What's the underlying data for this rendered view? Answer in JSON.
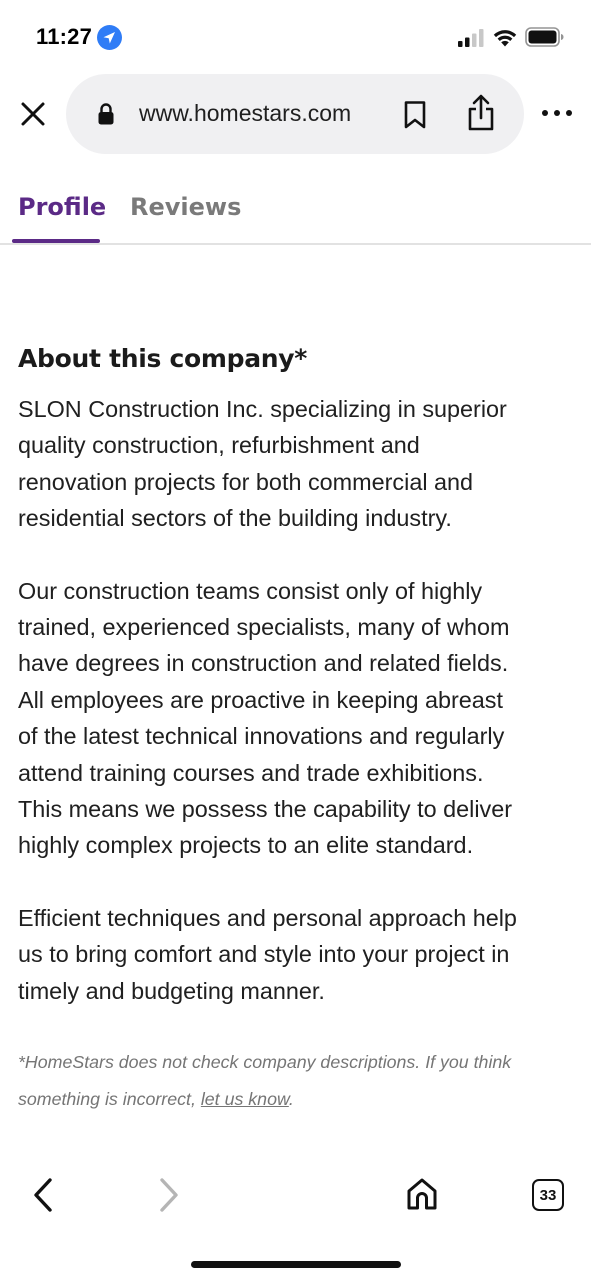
{
  "status_bar": {
    "time": "11:27",
    "icons": [
      "location-arrow-icon",
      "cellular-signal-icon",
      "wifi-icon",
      "battery-icon"
    ]
  },
  "browser": {
    "url": "www.homestars.com",
    "icons": [
      "close-icon",
      "lock-icon",
      "bookmark-icon",
      "share-icon",
      "more-icon"
    ]
  },
  "tabs": {
    "items": [
      {
        "label": "Profile",
        "active": true
      },
      {
        "label": "Reviews",
        "active": false
      }
    ],
    "active_color": "#5b2a86"
  },
  "about": {
    "heading": "About this company*",
    "paragraphs": [
      "SLON Construction Inc. specializing in superior\nquality construction, refurbishment and\nrenovation projects for both commercial and\nresidential sectors of the building industry.",
      "Our construction teams consist only of highly\ntrained, experienced specialists, many of whom\nhave degrees in construction and related fields.\nAll employees are proactive in keeping abreast\nof the latest technical innovations and regularly\nattend training courses and trade exhibitions.\nThis means we possess the capability to deliver\nhighly complex projects to an elite standard.",
      "Efficient techniques and personal approach help\nus to bring comfort and style into your project in\ntimely and budgeting manner."
    ],
    "disclaimer_text": "*HomeStars does not check company descriptions. If you think something is incorrect,",
    "disclaimer_link": "let us know",
    "disclaimer_end": "."
  },
  "toolbar": {
    "tab_count": "33",
    "icons": [
      "chevron-left-icon",
      "chevron-right-icon",
      "home-icon",
      "tabs-icon"
    ]
  }
}
